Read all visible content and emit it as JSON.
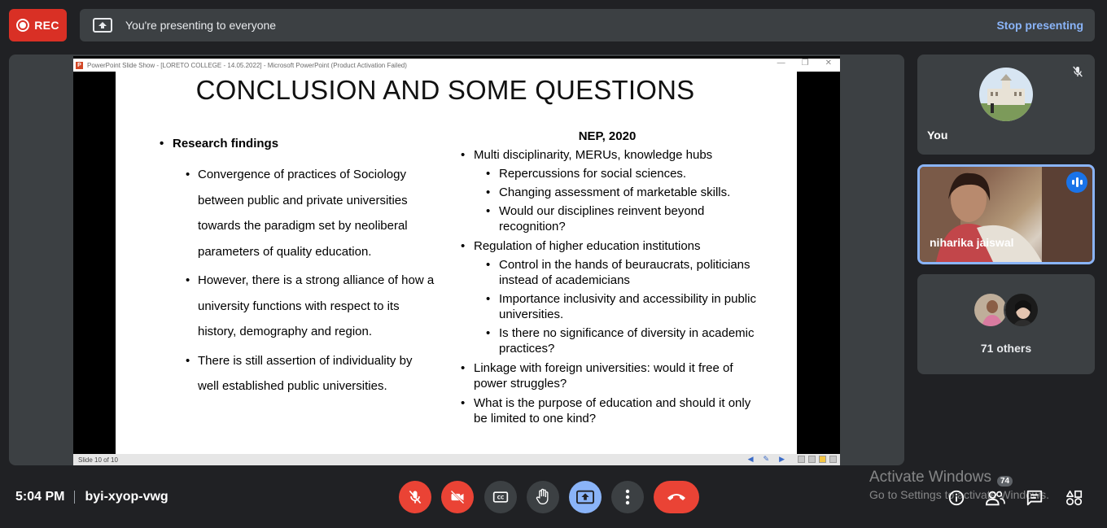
{
  "recording": {
    "label": "REC"
  },
  "presenting_bar": {
    "message": "You're presenting to everyone",
    "stop_label": "Stop presenting"
  },
  "powerpoint": {
    "window_title": "PowerPoint Slide Show - [LORETO COLLEGE - 14.05.2022] - Microsoft PowerPoint (Product Activation Failed)",
    "status_text": "Slide 10 of 10"
  },
  "slide": {
    "title": "CONCLUSION AND SOME QUESTIONS",
    "left_heading": "Research findings",
    "left_points": [
      "Convergence of practices of Sociology between public and private universities towards the paradigm set by neoliberal parameters of quality education.",
      "However, there is a strong alliance of how a university functions with respect to its history, demography and region.",
      "There is still assertion of individuality by well established public universities."
    ],
    "right_heading": "NEP, 2020",
    "right_items": [
      {
        "text": "Multi disciplinarity, MERUs, knowledge hubs",
        "sub": [
          "Repercussions for social sciences.",
          "Changing assessment of marketable skills.",
          "Would our disciplines reinvent beyond recognition?"
        ]
      },
      {
        "text": "Regulation of higher education institutions",
        "sub": [
          "Control in the hands of beuraucrats, politicians instead of academicians",
          "Importance inclusivity and accessibility in public universities.",
          "Is there no significance of diversity in academic practices?"
        ]
      },
      {
        "text": "Linkage with foreign universities: would it free of power struggles?",
        "sub": []
      },
      {
        "text": "What is the purpose of education and should it only be limited to one kind?",
        "sub": []
      }
    ]
  },
  "participants": {
    "you_label": "You",
    "speaker_name": "niharika jaiswal",
    "others_label": "71 others"
  },
  "meeting": {
    "time": "5:04 PM",
    "code": "byi-xyop-vwg"
  },
  "watermark": {
    "title": "Activate Windows",
    "subtitle": "Go to Settings to activate Windows."
  },
  "people_count": "74",
  "colors": {
    "accent": "#8ab4f8",
    "danger": "#ea4335",
    "bg": "#202124",
    "surface": "#3c4043"
  }
}
